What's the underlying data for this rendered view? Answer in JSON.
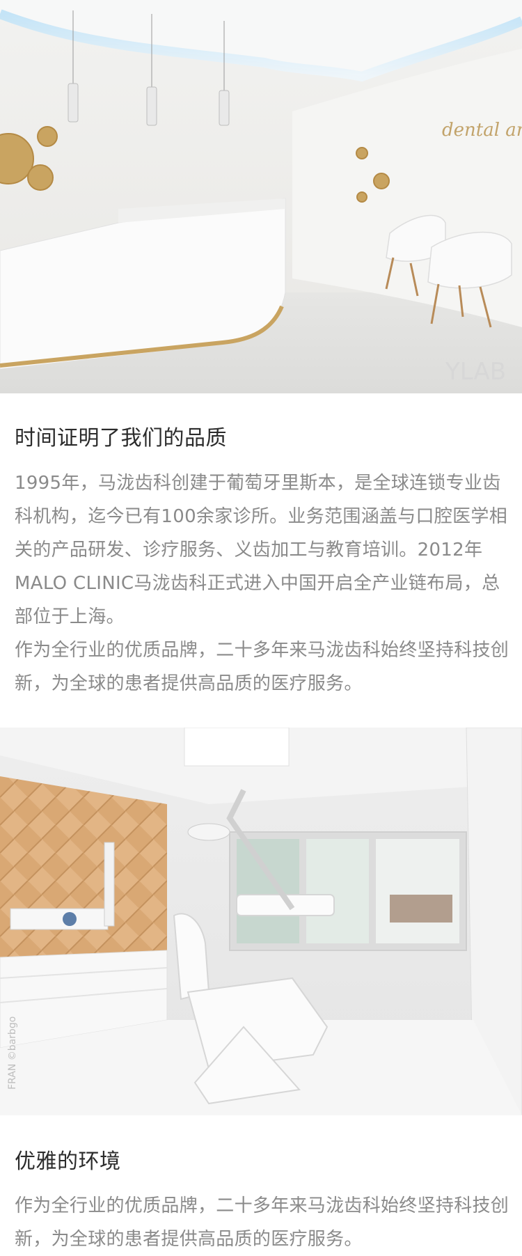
{
  "sections": [
    {
      "image_alt": "明亮的白色诊所前台与白色椅子",
      "image_watermark": "YLAB",
      "image_sign": "dental angels",
      "title": "时间证明了我们的品质",
      "paragraphs": [
        "1995年，马泷齿科创建于葡萄牙里斯本，是全球连锁专业齿科机构，迄今已有100余家诊所。业务范围涵盖与口腔医学相关的产品研发、诊疗服务、义齿加工与教育培训。2012年MALO CLINIC马泷齿科正式进入中国开启全产业链布局，总部位于上海。",
        "作为全行业的优质品牌，二十多年来马泷齿科始终坚持科技创新，为全球的患者提供高品质的医疗服务。"
      ]
    },
    {
      "image_alt": "白色牙科诊疗室与木纹墙面",
      "image_watermark": "FRAN ©barbgo",
      "title": "优雅的环境",
      "paragraphs": [
        "作为全行业的优质品牌，二十多年来马泷齿科始终坚持科技创新，为全球的患者提供高品质的医疗服务。"
      ]
    }
  ],
  "colors": {
    "title": "#2b2b2b",
    "body_text": "#8a8a8a",
    "accent_gold": "#c9a461",
    "wood": "#d9a874"
  }
}
